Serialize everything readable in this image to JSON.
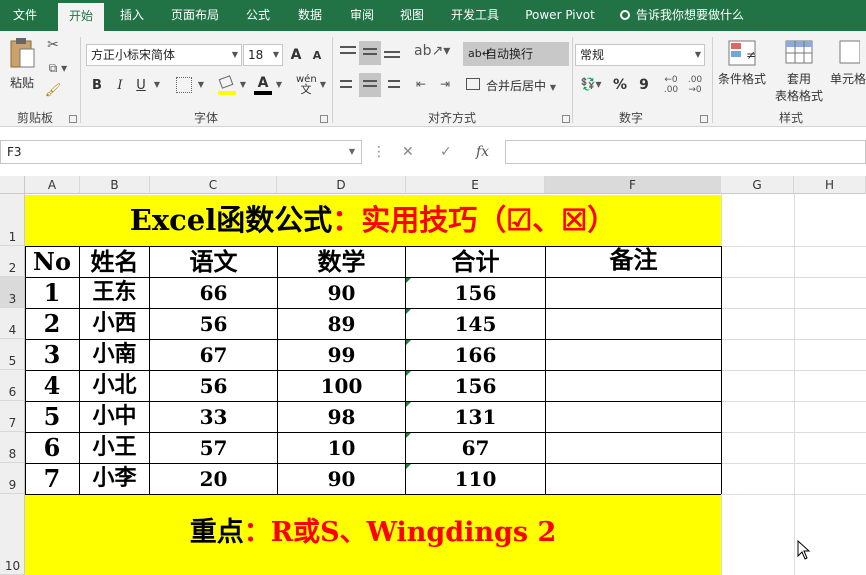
{
  "tabs": [
    "文件",
    "开始",
    "插入",
    "页面布局",
    "公式",
    "数据",
    "审阅",
    "视图",
    "开发工具",
    "Power Pivot"
  ],
  "tell_me": "告诉我你想要做什么",
  "ribbon": {
    "clipboard": {
      "paste": "粘贴",
      "label": "剪贴板"
    },
    "font": {
      "name": "方正小标宋简体",
      "size": "18",
      "bold": "B",
      "italic": "I",
      "underline": "U",
      "font_color_letter": "A",
      "grow": "A",
      "shrink": "A",
      "phonetic": "wén",
      "label": "字体"
    },
    "alignment": {
      "wrap": "自动换行",
      "merge": "合并后居中",
      "label": "对齐方式"
    },
    "number": {
      "format": "常规",
      "percent": "%",
      "comma": "9",
      "label": "数字"
    },
    "styles": {
      "conditional": "条件格式",
      "table_format_1": "套用",
      "table_format_2": "表格格式",
      "cell_styles": "单元格",
      "label": "样式"
    }
  },
  "formula_bar": {
    "name_box": "F3",
    "fx": "fx",
    "cancel": "✕",
    "enter": "✓",
    "value": ""
  },
  "columns": [
    "A",
    "B",
    "C",
    "D",
    "E",
    "F",
    "G",
    "H"
  ],
  "rows": [
    "1",
    "2",
    "3",
    "4",
    "5",
    "6",
    "7",
    "8",
    "9",
    "10"
  ],
  "sheet": {
    "title_black": "Excel函数公式",
    "title_red": "：实用技巧（☑、☒）",
    "headers": [
      "No",
      "姓名",
      "语文",
      "数学",
      "合计",
      "备注"
    ],
    "records": [
      [
        "1",
        "王东",
        "66",
        "90",
        "156",
        ""
      ],
      [
        "2",
        "小西",
        "56",
        "89",
        "145",
        ""
      ],
      [
        "3",
        "小南",
        "67",
        "99",
        "166",
        ""
      ],
      [
        "4",
        "小北",
        "56",
        "100",
        "156",
        ""
      ],
      [
        "5",
        "小中",
        "33",
        "98",
        "131",
        ""
      ],
      [
        "6",
        "小王",
        "57",
        "10",
        "67",
        ""
      ],
      [
        "7",
        "小李",
        "20",
        "90",
        "110",
        ""
      ]
    ],
    "footer_black": "重点",
    "footer_red": "：R或S、Wingdings 2"
  },
  "colors": {
    "ribbon_green": "#217346",
    "highlight": "#ffff00",
    "accent_red": "#ff0000"
  }
}
